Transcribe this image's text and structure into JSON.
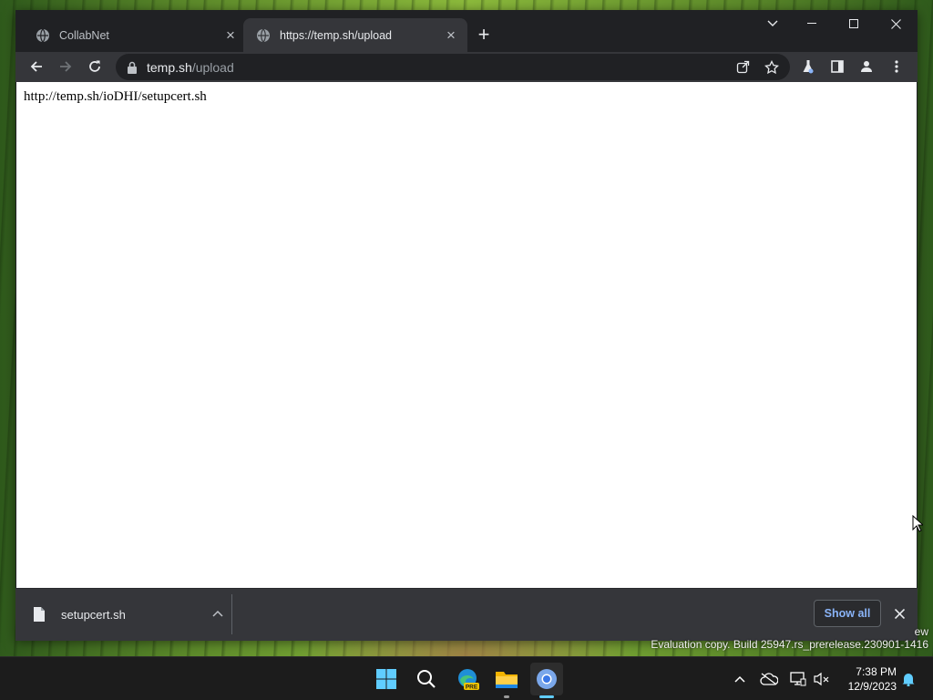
{
  "browser": {
    "tabs": [
      {
        "title": "CollabNet",
        "active": false
      },
      {
        "title": "https://temp.sh/upload",
        "active": true
      }
    ],
    "address": {
      "host": "temp.sh",
      "path": "/upload"
    },
    "page_text": "http://temp.sh/ioDHI/setupcert.sh",
    "downloads": {
      "file_name": "setupcert.sh",
      "show_all_label": "Show all"
    }
  },
  "desktop": {
    "watermark_fragment": "ew",
    "watermark": "Evaluation copy. Build 25947.rs_prerelease.230901-1416"
  },
  "taskbar": {
    "clock": {
      "time": "7:38 PM",
      "date": "12/9/2023"
    },
    "edge_badge": "PRE"
  },
  "colors": {
    "frame": "#202124",
    "toolbar": "#35363a",
    "link_accent": "#8ab4f8",
    "taskbar": "#1c1c1c",
    "windows_blue": "#60cdff"
  }
}
